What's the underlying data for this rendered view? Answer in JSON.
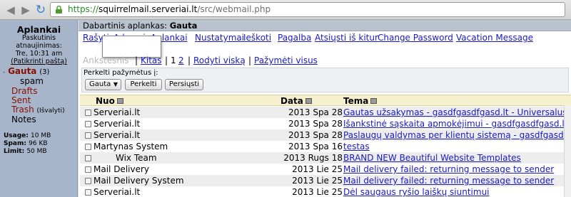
{
  "browser": {
    "url_scheme": "https://",
    "url_host": "squirrelmail.serveriai.lt",
    "url_path": "/src/webmail.php"
  },
  "left": {
    "title": "Aplankai",
    "last_refresh_label": "Paskutinis atnaujinimas:",
    "last_refresh_time": "Tre, 10:31 am",
    "check_mail": "(Patikrinti paštą)",
    "folders": [
      {
        "name": "Gauta",
        "count": "(3)"
      },
      {
        "name": "spam"
      },
      {
        "name": "Drafts"
      },
      {
        "name": "Sent"
      },
      {
        "name": "Trash",
        "purge": "(Išvalyti)"
      },
      {
        "name": "Notes"
      }
    ],
    "quota": [
      {
        "label": "Usage:",
        "value": "10 MB"
      },
      {
        "label": "Spam:",
        "value": "96 KB"
      },
      {
        "label": "Limit:",
        "value": "50 MB"
      }
    ]
  },
  "main": {
    "current_folder_label": "Dabartinis aplankas:",
    "current_folder": "Gauta",
    "menu": [
      "Rašyti",
      "Adresai",
      "Aplankai",
      "Nustatymai",
      "Ieškoti",
      "Pagalba",
      "Atsiųsti iš kitur",
      "Change Password",
      "Vacation Message"
    ],
    "pager": {
      "prev": "Ankstesnis",
      "sep1": "|",
      "next": "Kitas",
      "sep2": "|",
      "page1": "1",
      "page2": "2",
      "sep3": "|",
      "show_all": "Rodyti viską",
      "sep4": "|",
      "select_all": "Pažymėti visus"
    },
    "move": {
      "label": "Perkelti pažymėtus į:",
      "selected_folder": "Gauta",
      "move_button": "Perkelti",
      "forward_button": "Persiųsti"
    },
    "columns": {
      "from": "Nuo",
      "date": "Data",
      "subject": "Tema"
    },
    "messages": [
      {
        "from": "Serveriai.lt",
        "date": "2013 Spa 28",
        "subject": "Gautas užsakymas - gasdfgasdfgasd.lt - Universalus"
      },
      {
        "from": "Serveriai.lt",
        "date": "2013 Spa 28",
        "subject": "Išankstinė sąskaita apmokėjimui - gasdfgasdfgasd.l..."
      },
      {
        "from": "Serveriai.lt",
        "date": "2013 Spa 28",
        "subject": "Paslaugų valdymas per klientų sistemą - gasdfgasdf..."
      },
      {
        "from": "Martynas System",
        "date": "2013 Spa 16",
        "subject": "testas"
      },
      {
        "from": "Wix Team",
        "date": "2013 Rugs 18",
        "subject": "BRAND NEW Beautiful Website Templates",
        "centered": true
      },
      {
        "from": "Mail Delivery",
        "date": "2013 Lie 25",
        "subject": "Mail delivery failed: returning message to sender"
      },
      {
        "from": "Mail Delivery System",
        "date": "2013 Lie 25",
        "subject": "Mail delivery failed: returning message to sender"
      },
      {
        "from": "Serveriai.lt",
        "date": "2013 Lie 25",
        "subject": "Dėl saugaus ryšio laiškų siuntimui"
      }
    ]
  },
  "colors": {
    "left_pane": "#a7b5cb",
    "folder_link": "#8a1000",
    "link": "#1a1ac8",
    "header_row": "#f6f0cf"
  }
}
